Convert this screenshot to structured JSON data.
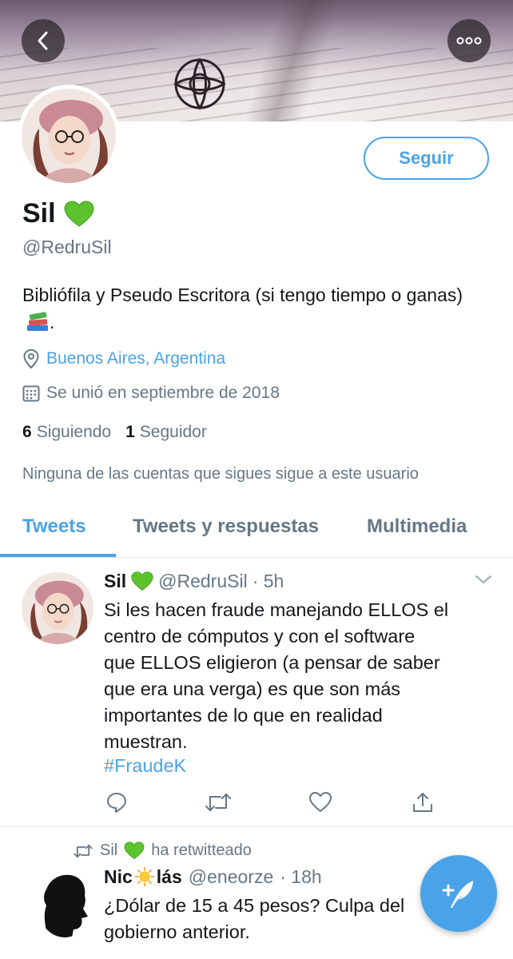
{
  "colors": {
    "accent": "#4aa3e8",
    "secondary_text": "#657786",
    "heart_green": "#5cc22e"
  },
  "header": {
    "back_icon": "chevron-left-icon",
    "more_icon": "more-icon"
  },
  "profile": {
    "name": "Sil",
    "name_emoji": "green-heart",
    "handle": "@RedruSil",
    "follow_label": "Seguir",
    "bio": "Bibliófila y Pseudo Escritora (si tengo tiempo o ganas)",
    "bio_emoji": "books-icon",
    "bio_end": ".",
    "location": "Buenos Aires, Argentina",
    "joined": "Se unió en septiembre de 2018",
    "following_count": "6",
    "following_label": "Siguiendo",
    "followers_count": "1",
    "followers_label": "Seguidor",
    "mutual_notice": "Ninguna de las cuentas que sigues sigue a este usuario"
  },
  "tabs": [
    {
      "label": "Tweets",
      "active": true
    },
    {
      "label": "Tweets y respuestas",
      "active": false
    },
    {
      "label": "Multimedia",
      "active": false
    }
  ],
  "tweets": [
    {
      "name": "Sil",
      "handle": "@RedruSil",
      "time": "· 5h",
      "lines": [
        "Si les hacen fraude manejando ELLOS el",
        "centro de cómputos y con el software",
        "que ELLOS eligieron (a pensar de saber",
        "que era una verga) es que son más",
        "importantes de lo que en realidad",
        "muestran."
      ],
      "hashtag": "#FraudeK"
    },
    {
      "retweet_by": "Sil",
      "retweet_label": "ha retwitteado",
      "name_start": "Nic",
      "name_end": "lás",
      "handle": "@eneorze",
      "time": "· 18h",
      "lines": [
        "¿Dólar de 15 a 45 pesos? Culpa del",
        "gobierno anterior."
      ]
    }
  ],
  "compose_icon": "compose-tweet-icon"
}
